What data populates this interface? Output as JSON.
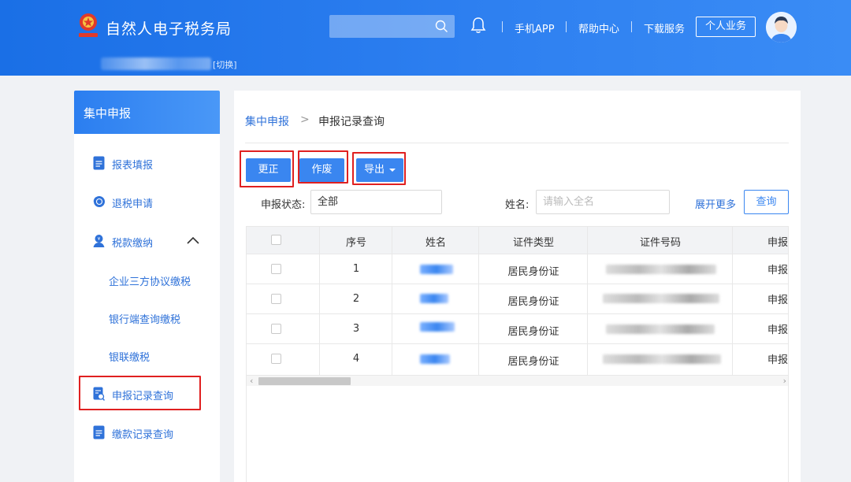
{
  "header": {
    "site_title": "自然人电子税务局",
    "search_placeholder": "",
    "nav": [
      "手机APP",
      "帮助中心",
      "下载服务"
    ],
    "personal_button": "个人业务",
    "switch_label": "[切换]",
    "user_name_visible": false
  },
  "sidebar": {
    "title": "集中申报",
    "items": [
      {
        "label": "报表填报",
        "icon": "report-form-icon"
      },
      {
        "label": "退税申请",
        "icon": "refund-icon"
      },
      {
        "label": "税款缴纳",
        "icon": "tax-payment-icon",
        "expanded": true,
        "children": [
          "企业三方协议缴税",
          "银行端查询缴税",
          "银联缴税"
        ]
      },
      {
        "label": "申报记录查询",
        "icon": "record-search-icon",
        "active": true
      },
      {
        "label": "缴款记录查询",
        "icon": "payment-record-icon"
      }
    ]
  },
  "main": {
    "breadcrumb": [
      "集中申报",
      "申报记录查询"
    ],
    "breadcrumb_separator": ">",
    "buttons": {
      "correct": "更正",
      "void": "作废",
      "export": "导出"
    },
    "filters": {
      "status_label": "申报状态:",
      "status_value": "全部",
      "name_label": "姓名:",
      "name_placeholder": "请输入全名",
      "expand_more": "展开更多",
      "query": "查询"
    },
    "table": {
      "columns": [
        "序号",
        "姓名",
        "证件类型",
        "证件号码",
        "申报"
      ],
      "rows": [
        {
          "index": "1",
          "id_type": "居民身份证",
          "status": "申报"
        },
        {
          "index": "2",
          "id_type": "居民身份证",
          "status": "申报"
        },
        {
          "index": "3",
          "id_type": "居民身份证",
          "status": "申报"
        },
        {
          "index": "4",
          "id_type": "居民身份证",
          "status": "申报"
        }
      ]
    }
  },
  "colors": {
    "primary": "#3a86f0",
    "link": "#2f72d9",
    "highlight": "#e02020",
    "header_bg": "#2d7ff0"
  }
}
